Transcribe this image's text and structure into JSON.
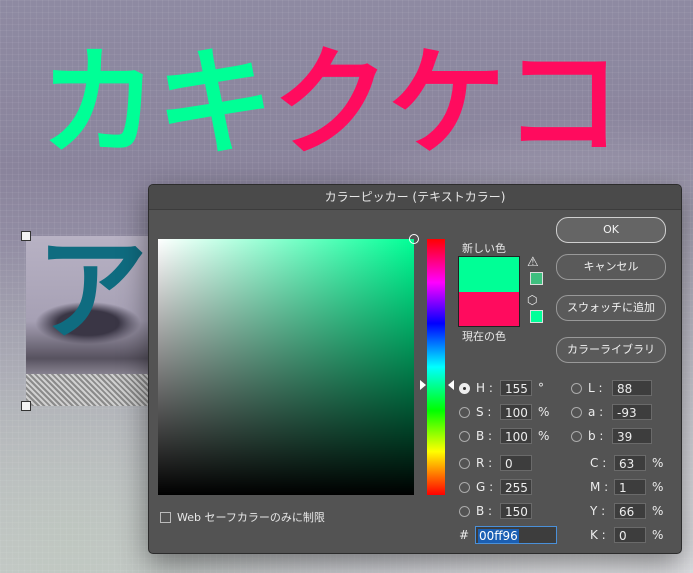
{
  "background_text": {
    "part1": "カキ",
    "part2": "クケコ",
    "color1": "#00ff96",
    "color2": "#ff0b5e"
  },
  "layer_preview": {
    "glyph": "ア",
    "glyph_color": "#0f6c80"
  },
  "dialog": {
    "title": "カラーピッカー (テキストカラー)",
    "new_label": "新しい色",
    "current_label": "現在の色",
    "new_color": "#00ff96",
    "current_color": "#ff0b5e",
    "buttons": {
      "ok": "OK",
      "cancel": "キャンセル",
      "add_swatch": "スウォッチに追加",
      "color_library": "カラーライブラリ"
    },
    "hsb": {
      "h_label": "H :",
      "h_value": "155",
      "h_unit": "°",
      "s_label": "S :",
      "s_value": "100",
      "s_unit": "%",
      "b_label": "B :",
      "b_value": "100",
      "b_unit": "%"
    },
    "rgb": {
      "r_label": "R :",
      "r_value": "0",
      "g_label": "G :",
      "g_value": "255",
      "b_label": "B :",
      "b_value": "150"
    },
    "lab": {
      "l_label": "L :",
      "l_value": "88",
      "a_label": "a :",
      "a_value": "-93",
      "b_label": "b :",
      "b_value": "39"
    },
    "cmyk": {
      "c_label": "C :",
      "c_value": "63",
      "c_unit": "%",
      "m_label": "M :",
      "m_value": "1",
      "m_unit": "%",
      "y_label": "Y :",
      "y_value": "66",
      "y_unit": "%",
      "k_label": "K :",
      "k_value": "0",
      "k_unit": "%"
    },
    "hex_label": "#",
    "hex_value": "00ff96",
    "web_only_label": "Web セーフカラーのみに制限",
    "icons": {
      "warning": "gamut-warning-icon",
      "cube": "web-safe-cube-icon"
    }
  }
}
